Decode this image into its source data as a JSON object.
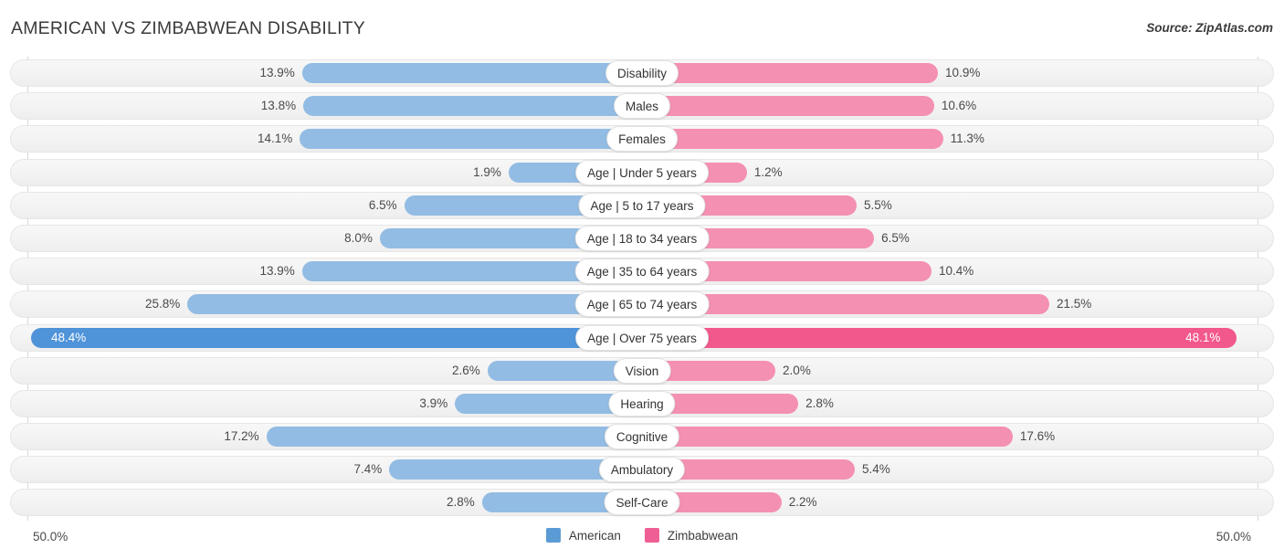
{
  "header": {
    "title": "AMERICAN VS ZIMBABWEAN DISABILITY",
    "source": "Source: ZipAtlas.com"
  },
  "axis": {
    "left_label": "50.0%",
    "right_label": "50.0%"
  },
  "legend": [
    {
      "label": "American",
      "color": "#5b9bd5"
    },
    {
      "label": "Zimbabwean",
      "color": "#ef5f96"
    }
  ],
  "colors": {
    "left_light": "#92bce3",
    "right_light": "#f490b1",
    "left_dark": "#4f93d9",
    "right_dark": "#f2588c"
  },
  "chart_data": {
    "type": "bar",
    "title": "AMERICAN VS ZIMBABWEAN DISABILITY",
    "subtitle": "Source: ZipAtlas.com",
    "orientation": "horizontal-diverging",
    "xlabel": "",
    "ylabel": "",
    "xlim": [
      50.0,
      50.0
    ],
    "grid": false,
    "legend_position": "bottom-center",
    "categories": [
      "Disability",
      "Males",
      "Females",
      "Age | Under 5 years",
      "Age | 5 to 17 years",
      "Age | 18 to 34 years",
      "Age | 35 to 64 years",
      "Age | 65 to 74 years",
      "Age | Over 75 years",
      "Vision",
      "Hearing",
      "Cognitive",
      "Ambulatory",
      "Self-Care"
    ],
    "series": [
      {
        "name": "American",
        "values": [
          13.9,
          13.8,
          14.1,
          1.9,
          6.5,
          8.0,
          13.9,
          25.8,
          48.4,
          2.6,
          3.9,
          17.2,
          7.4,
          2.8
        ],
        "labels": [
          "13.9%",
          "13.8%",
          "14.1%",
          "1.9%",
          "6.5%",
          "8.0%",
          "13.9%",
          "25.8%",
          "48.4%",
          "2.6%",
          "3.9%",
          "17.2%",
          "7.4%",
          "2.8%"
        ]
      },
      {
        "name": "Zimbabwean",
        "values": [
          10.9,
          10.6,
          11.3,
          1.2,
          5.5,
          6.5,
          10.4,
          21.5,
          48.1,
          2.0,
          2.8,
          17.6,
          5.4,
          2.2
        ],
        "labels": [
          "10.9%",
          "10.6%",
          "11.3%",
          "1.2%",
          "5.5%",
          "6.5%",
          "10.4%",
          "21.5%",
          "48.1%",
          "2.0%",
          "2.8%",
          "17.6%",
          "5.4%",
          "2.2%"
        ]
      }
    ],
    "highlighted_row": "Age | Over 75 years"
  }
}
